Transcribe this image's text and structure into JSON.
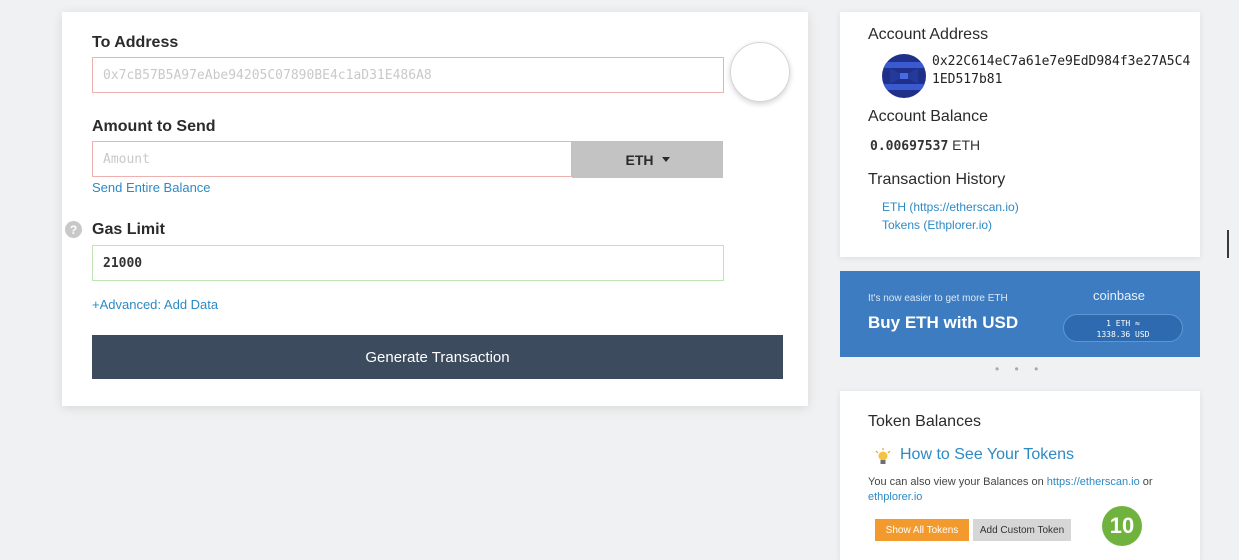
{
  "send_form": {
    "to_address_label": "To Address",
    "to_address_placeholder": "0x7cB57B5A97eAbe94205C07890BE4c1aD31E486A8",
    "amount_label": "Amount to Send",
    "amount_placeholder": "Amount",
    "currency": "ETH",
    "send_entire_balance": "Send Entire Balance",
    "gas_limit_label": "Gas Limit",
    "gas_limit_value": "21000",
    "advanced_link": "+Advanced: Add Data",
    "generate_button": "Generate Transaction",
    "help_glyph": "?"
  },
  "account": {
    "address_heading": "Account Address",
    "address": "0x22C614eC7a61e7e9EdD984f3e27A5C41ED517b81",
    "balance_heading": "Account Balance",
    "balance_value": "0.00697537",
    "balance_unit": "ETH",
    "history_heading": "Transaction History",
    "history_links": [
      "ETH (https://etherscan.io)",
      "Tokens (Ethplorer.io)"
    ]
  },
  "promo": {
    "small_text": "It's now easier to get more ETH",
    "title": "Buy ETH with USD",
    "brand": "coinbase",
    "rate_line1": "1 ETH ≈",
    "rate_line2": "1338.36 USD",
    "dots": "• • •"
  },
  "tokens": {
    "heading": "Token Balances",
    "howto_link": "How to See Your Tokens",
    "text_prefix": "You can also view your Balances on ",
    "link_etherscan": "https://etherscan.io",
    "text_or": " or ",
    "link_ethplorer": "ethplorer.io",
    "show_all_button": "Show All Tokens",
    "add_custom_button": "Add Custom Token"
  },
  "step_badge": "10",
  "icons": {
    "help": "help-icon",
    "dropdown": "chevron-down-icon",
    "identicon": "identicon-icon",
    "bulb": "lightbulb-icon"
  },
  "colors": {
    "primary_button": "#3c4b5e",
    "link": "#2d8ac4",
    "promo_bg": "#3d7cc0",
    "orange_button": "#f39a2e",
    "badge": "#6fb23e",
    "invalid_border": "#efb0b0",
    "valid_border": "#bfe3b4"
  }
}
